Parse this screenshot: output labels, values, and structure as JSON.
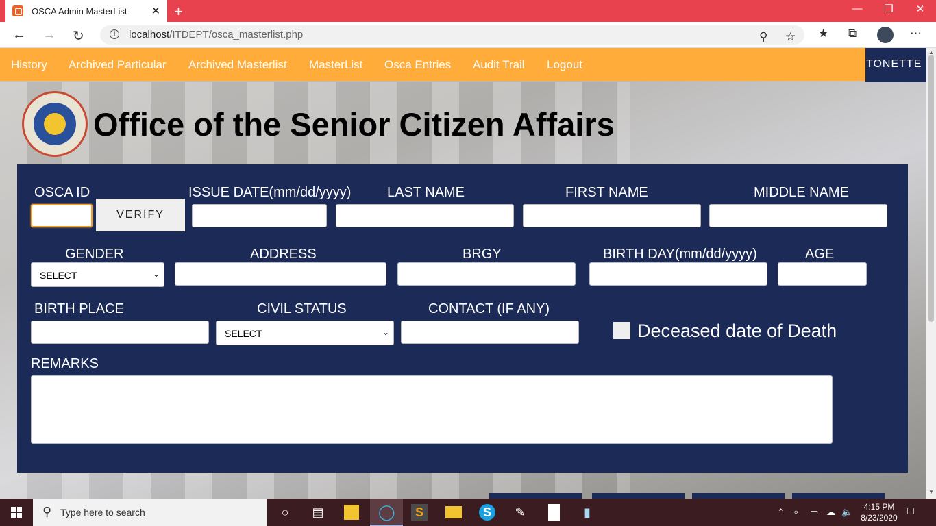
{
  "browser": {
    "tab_title": "OSCA Admin MasterList",
    "tab_close": "✕",
    "new_tab": "+",
    "url_host": "localhost",
    "url_path": "/ITDEPT/osca_masterlist.php"
  },
  "nav": {
    "items": [
      "History",
      "Archived Particular",
      "Archived Masterlist",
      "MasterList",
      "Osca Entries",
      "Audit Trail",
      "Logout"
    ],
    "user": "TONETTE"
  },
  "header": {
    "title": "Office of the Senior Citizen Affairs"
  },
  "form": {
    "osca_id_label": "OSCA ID",
    "verify_label": "VERIFY",
    "issue_date_label": "ISSUE DATE(mm/dd/yyyy)",
    "last_name_label": "LAST NAME",
    "first_name_label": "FIRST NAME",
    "middle_name_label": "MIDDLE NAME",
    "gender_label": "GENDER",
    "gender_value": "SELECT",
    "address_label": "ADDRESS",
    "brgy_label": "BRGY",
    "birthday_label": "BIRTH DAY(mm/dd/yyyy)",
    "age_label": "AGE",
    "birthplace_label": "BIRTH PLACE",
    "civil_status_label": "CIVIL STATUS",
    "civil_status_value": "SELECT",
    "contact_label": "CONTACT (IF ANY)",
    "deceased_label": "Deceased date of Death",
    "remarks_label": "REMARKS"
  },
  "taskbar": {
    "search_placeholder": "Type here to search",
    "time": "4:15 PM",
    "date": "8/23/2020"
  }
}
